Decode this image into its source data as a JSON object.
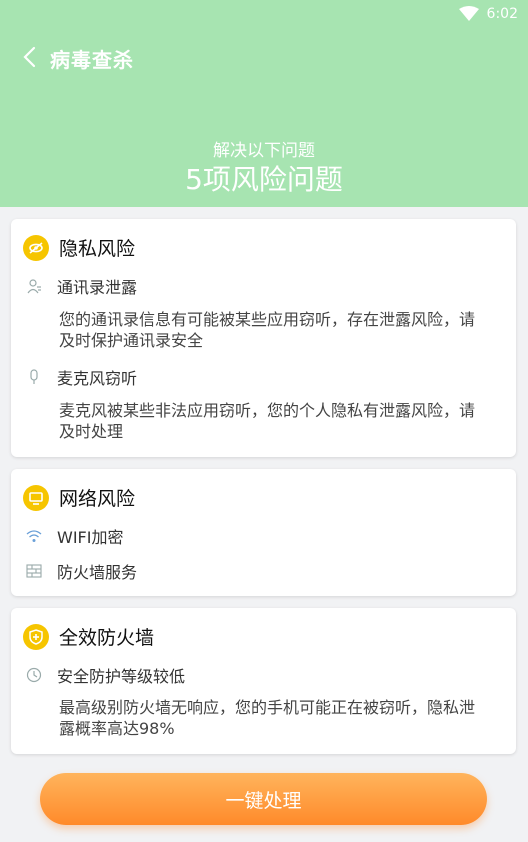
{
  "status": {
    "time": "6:02"
  },
  "header": {
    "title": "病毒查杀",
    "subtitle": "解决以下问题",
    "headline": "5项风险问题"
  },
  "cards": [
    {
      "title": "隐私风险",
      "items": [
        {
          "label": "通讯录泄露",
          "desc": "您的通讯录信息有可能被某些应用窃听，存在泄露风险，请及时保护通讯录安全",
          "icon": "contact-icon"
        },
        {
          "label": "麦克风窃听",
          "desc": "麦克风被某些非法应用窃听，您的个人隐私有泄露风险，请及时处理",
          "icon": "microphone-icon"
        }
      ]
    },
    {
      "title": "网络风险",
      "items": [
        {
          "label": "WIFI加密",
          "icon": "wifi-icon"
        },
        {
          "label": "防火墙服务",
          "icon": "firewall-icon"
        }
      ]
    },
    {
      "title": "全效防火墙",
      "items": [
        {
          "label": "安全防护等级较低",
          "desc": "最高级别防火墙无响应，您的手机可能正在被窃听，隐私泄露概率高达98%",
          "icon": "clock-icon"
        }
      ]
    }
  ],
  "action": {
    "label": "一键处理"
  },
  "colors": {
    "header": "#a7e4b1",
    "badge": "#f6c500",
    "button": "#ff9a3c"
  }
}
